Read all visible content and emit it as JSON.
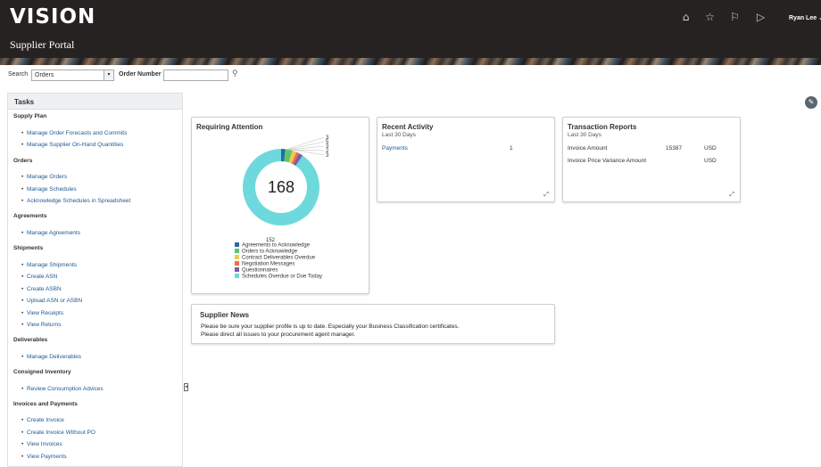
{
  "header": {
    "logo": "VISION",
    "subtitle": "Supplier Portal",
    "icons": [
      "home-icon",
      "star-icon",
      "flag-icon",
      "send-icon"
    ],
    "user": "Ryan Lee"
  },
  "search": {
    "label": "Search",
    "selected": "Orders",
    "order_number_label": "Order Number",
    "order_number_value": ""
  },
  "tasks": {
    "title": "Tasks",
    "sections": [
      {
        "title": "Supply Plan",
        "items": [
          "Manage Order Forecasts and Commits",
          "Manage Supplier On-Hand Quantities"
        ]
      },
      {
        "title": "Orders",
        "items": [
          "Manage Orders",
          "Manage Schedules",
          "Acknowledge Schedules in Spreadsheet"
        ]
      },
      {
        "title": "Agreements",
        "items": [
          "Manage Agreements"
        ]
      },
      {
        "title": "Shipments",
        "items": [
          "Manage Shipments",
          "Create ASN",
          "Create ASBN",
          "Upload ASN or ASBN",
          "View Receipts",
          "View Returns"
        ]
      },
      {
        "title": "Deliverables",
        "items": [
          "Manage Deliverables"
        ]
      },
      {
        "title": "Consigned Inventory",
        "items": [
          "Review Consumption Advices"
        ]
      },
      {
        "title": "Invoices and Payments",
        "items": [
          "Create Invoice",
          "Create Invoice Without PO",
          "View Invoices",
          "View Payments"
        ]
      }
    ]
  },
  "attention": {
    "title": "Requiring Attention",
    "total": "168",
    "callouts": [
      "3",
      "5",
      "3",
      "2",
      "3"
    ],
    "bottom_label": "152",
    "legend": [
      {
        "label": "Agreements to Acknowledge",
        "color": "#2b6aa0"
      },
      {
        "label": "Orders to Acknowledge",
        "color": "#5cc46d"
      },
      {
        "label": "Contract Deliverables Overdue",
        "color": "#f2c94c"
      },
      {
        "label": "Negotiation Messages",
        "color": "#e8734a"
      },
      {
        "label": "Questionnaires",
        "color": "#7b5ea7"
      },
      {
        "label": "Schedules Overdue or Due Today",
        "color": "#6ed9dc"
      }
    ]
  },
  "chart_data": {
    "type": "pie",
    "title": "Requiring Attention",
    "categories": [
      "Agreements to Acknowledge",
      "Orders to Acknowledge",
      "Contract Deliverables Overdue",
      "Negotiation Messages",
      "Questionnaires",
      "Schedules Overdue or Due Today"
    ],
    "values": [
      3,
      5,
      3,
      2,
      3,
      152
    ],
    "colors": [
      "#2b6aa0",
      "#5cc46d",
      "#f2c94c",
      "#e8734a",
      "#7b5ea7",
      "#6ed9dc"
    ],
    "legend": "bottom"
  },
  "activity": {
    "title": "Recent Activity",
    "subtitle": "Last 30 Days",
    "rows": [
      {
        "label": "Payments",
        "value": "1"
      }
    ]
  },
  "reports": {
    "title": "Transaction Reports",
    "subtitle": "Last 30 Days",
    "rows": [
      {
        "label": "Invoice Amount",
        "value": "15387",
        "currency": "USD"
      },
      {
        "label": "Invoice Price Variance Amount",
        "value": "",
        "currency": "USD"
      }
    ]
  },
  "news": {
    "title": "Supplier News",
    "lines": [
      "Please be sure your supplier profile is up to date.  Especially your Business Classification certificates.",
      "Please direct all issues to your procurement agent manager."
    ]
  }
}
